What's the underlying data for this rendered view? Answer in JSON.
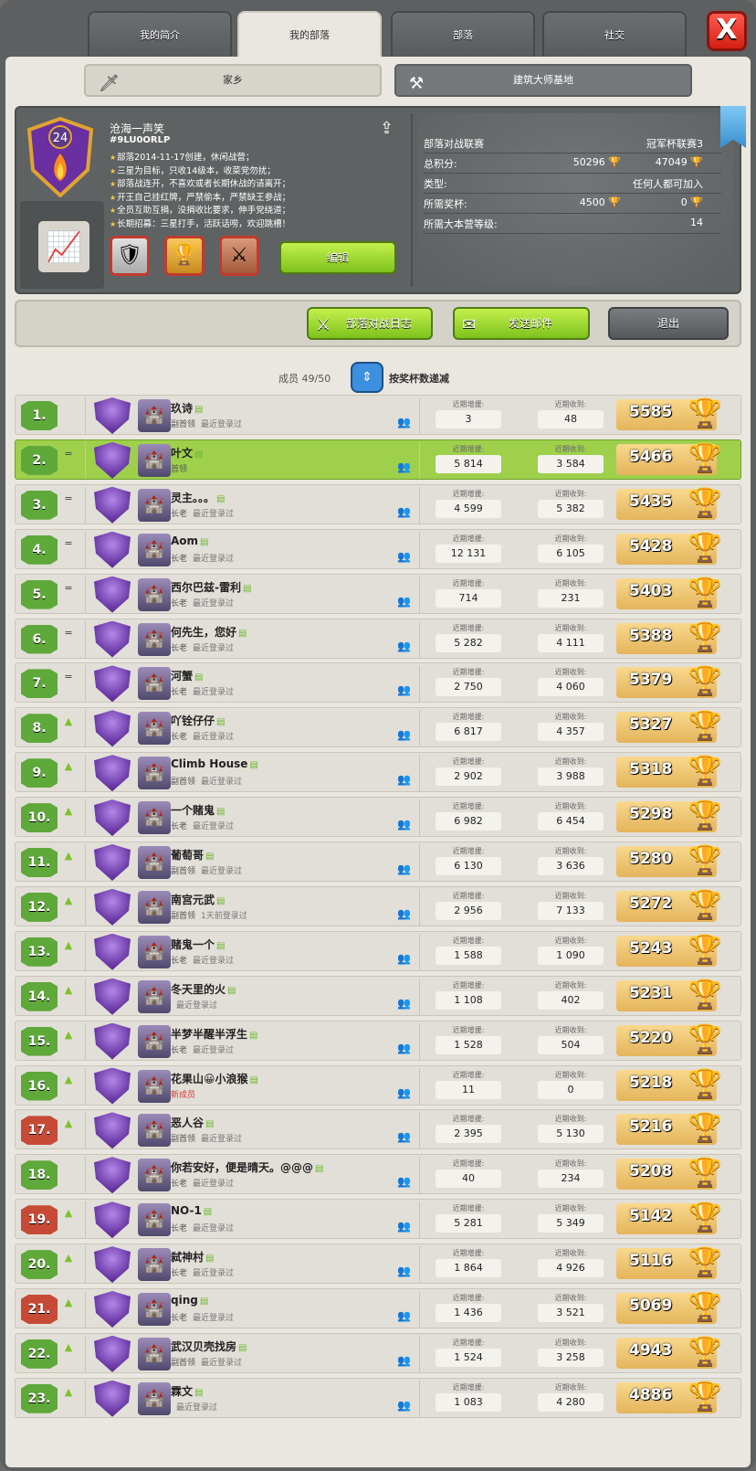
{
  "tabs": [
    "我的简介",
    "我的部落",
    "部落",
    "社交"
  ],
  "close_label": "X",
  "subtabs": {
    "home": "家乡",
    "builder": "建筑大师基地"
  },
  "clan": {
    "level": "24",
    "name": "沧海一声笑",
    "tag": "#9LU0ORLP",
    "description": [
      "部落2014-11-17创建，休闲战营；",
      "三星为目标，只收14级本，收菜党勿扰；",
      "部落战连开，不喜欢或者长期休战的请离开；",
      "开王自己挂红牌，严禁偷本，严禁缺王参战；",
      "全员互助互捐，没捐收比要求，伸手党绕道；",
      "长期招募：三星打手，活跃话唠，欢迎跳槽！"
    ],
    "edit_label": "编辑"
  },
  "stats": {
    "war_league_label": "部落对战联赛",
    "war_league": "冠军杯联赛3",
    "total_points_label": "总积分:",
    "points_home": "50296",
    "points_builder": "47049",
    "type_label": "类型:",
    "type": "任何人都可加入",
    "required_trophies_label": "所需奖杯:",
    "req_home": "4500",
    "req_builder": "0",
    "required_th_label": "所需大本营等级:",
    "req_th": "14"
  },
  "actions": {
    "war_log": "部落对战日志",
    "send_mail": "发送邮件",
    "leave": "退出"
  },
  "sort": {
    "members": "成员 49/50",
    "label": "按奖杯数递减"
  },
  "labels": {
    "donated": "近期增援:",
    "received": "近期收到:",
    "last_online": "最近登录过"
  },
  "members": [
    {
      "rank": "1.",
      "chg": "",
      "name": "玖诗",
      "role": "副首领",
      "last": "最近登录过",
      "don": "3",
      "rec": "48",
      "trophies": "5585"
    },
    {
      "rank": "2.",
      "chg": "=",
      "name": "叶文",
      "role": "首领",
      "last": "",
      "don": "5 814",
      "rec": "3 584",
      "trophies": "5466",
      "me": true
    },
    {
      "rank": "3.",
      "chg": "=",
      "name": "灵主。。。",
      "role": "长老",
      "last": "最近登录过",
      "don": "4 599",
      "rec": "5 382",
      "trophies": "5435"
    },
    {
      "rank": "4.",
      "chg": "=",
      "name": "Aom",
      "role": "长老",
      "last": "最近登录过",
      "don": "12 131",
      "rec": "6 105",
      "trophies": "5428"
    },
    {
      "rank": "5.",
      "chg": "=",
      "name": "西尔巴兹-雷利",
      "role": "长老",
      "last": "最近登录过",
      "don": "714",
      "rec": "231",
      "trophies": "5403"
    },
    {
      "rank": "6.",
      "chg": "=",
      "name": "何先生，您好",
      "role": "长老",
      "last": "最近登录过",
      "don": "5 282",
      "rec": "4 111",
      "trophies": "5388"
    },
    {
      "rank": "7.",
      "chg": "=",
      "name": "河蟹",
      "role": "长老",
      "last": "最近登录过",
      "don": "2 750",
      "rec": "4 060",
      "trophies": "5379"
    },
    {
      "rank": "8.",
      "chg": "▲",
      "name": "吖铨仔仔",
      "role": "长老",
      "last": "最近登录过",
      "don": "6 817",
      "rec": "4 357",
      "trophies": "5327"
    },
    {
      "rank": "9.",
      "chg": "▲",
      "name": "Climb House",
      "role": "副首领",
      "last": "最近登录过",
      "don": "2 902",
      "rec": "3 988",
      "trophies": "5318"
    },
    {
      "rank": "10.",
      "chg": "▲",
      "name": "一个赌鬼",
      "role": "长老",
      "last": "最近登录过",
      "don": "6 982",
      "rec": "6 454",
      "trophies": "5298"
    },
    {
      "rank": "11.",
      "chg": "▲",
      "name": "葡萄哥",
      "role": "副首领",
      "last": "最近登录过",
      "don": "6 130",
      "rec": "3 636",
      "trophies": "5280"
    },
    {
      "rank": "12.",
      "chg": "▲",
      "name": "南宫元武",
      "role": "副首领",
      "last": "1天前登录过",
      "don": "2 956",
      "rec": "7 133",
      "trophies": "5272"
    },
    {
      "rank": "13.",
      "chg": "▲",
      "name": "赌鬼一个",
      "role": "长老",
      "last": "最近登录过",
      "don": "1 588",
      "rec": "1 090",
      "trophies": "5243"
    },
    {
      "rank": "14.",
      "chg": "▲",
      "name": "冬天里的火",
      "role": "",
      "last": "最近登录过",
      "don": "1 108",
      "rec": "402",
      "trophies": "5231"
    },
    {
      "rank": "15.",
      "chg": "▲",
      "name": "半梦半醒半浮生",
      "role": "长老",
      "last": "最近登录过",
      "don": "1 528",
      "rec": "504",
      "trophies": "5220"
    },
    {
      "rank": "16.",
      "chg": "▲",
      "name": "花果山😀小浪猴",
      "role": "新成员",
      "last": "",
      "don": "11",
      "rec": "0",
      "trophies": "5218",
      "new": true
    },
    {
      "rank": "17.",
      "chg": "▲",
      "name": "恶人谷",
      "role": "副首领",
      "last": "最近登录过",
      "don": "2 395",
      "rec": "5 130",
      "trophies": "5216",
      "red": true
    },
    {
      "rank": "18.",
      "chg": "",
      "name": "你若安好，便是晴天。@@@",
      "role": "长老",
      "last": "最近登录过",
      "don": "40",
      "rec": "234",
      "trophies": "5208"
    },
    {
      "rank": "19.",
      "chg": "▲",
      "name": "NO-1",
      "role": "长老",
      "last": "最近登录过",
      "don": "5 281",
      "rec": "5 349",
      "trophies": "5142",
      "red": true
    },
    {
      "rank": "20.",
      "chg": "▲",
      "name": "弑神村",
      "role": "长老",
      "last": "最近登录过",
      "don": "1 864",
      "rec": "4 926",
      "trophies": "5116"
    },
    {
      "rank": "21.",
      "chg": "▲",
      "name": "qing",
      "role": "长老",
      "last": "最近登录过",
      "don": "1 436",
      "rec": "3 521",
      "trophies": "5069",
      "red": true
    },
    {
      "rank": "22.",
      "chg": "▲",
      "name": "武汉贝壳找房",
      "role": "副首领",
      "last": "最近登录过",
      "don": "1 524",
      "rec": "3 258",
      "trophies": "4943"
    },
    {
      "rank": "23.",
      "chg": "▲",
      "name": "霖文",
      "role": "",
      "last": "最近登录过",
      "don": "1 083",
      "rec": "4 280",
      "trophies": "4886"
    }
  ]
}
